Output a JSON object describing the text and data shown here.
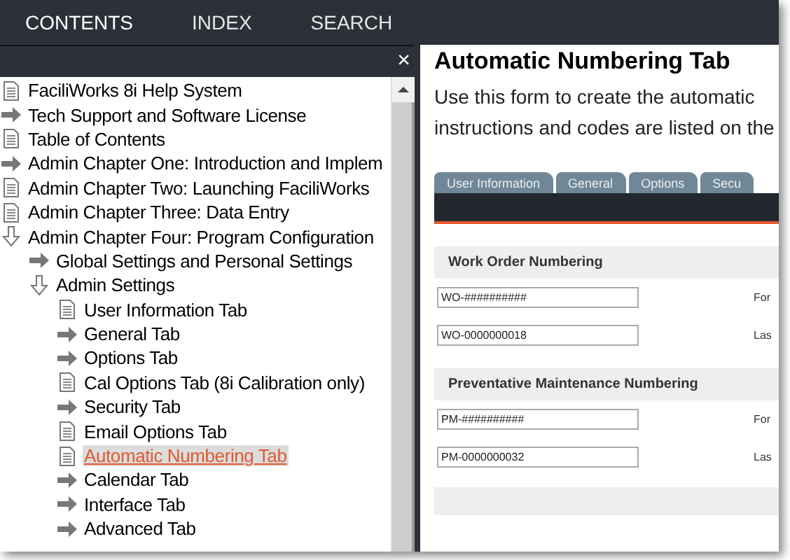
{
  "nav_tabs": [
    {
      "label": "CONTENTS",
      "selected": true
    },
    {
      "label": "INDEX",
      "selected": false
    },
    {
      "label": "SEARCH",
      "selected": false
    }
  ],
  "close_glyph": "×",
  "tree": [
    {
      "kind": "page",
      "label": "FaciliWorks 8i Help System",
      "selected": false
    },
    {
      "kind": "book",
      "label": "Tech Support and Software License",
      "selected": false
    },
    {
      "kind": "page",
      "label": "Table of Contents",
      "selected": false
    },
    {
      "kind": "book",
      "label": "Admin Chapter One: Introduction and Implem",
      "selected": false
    },
    {
      "kind": "page",
      "label": "Admin Chapter Two: Launching FaciliWorks",
      "selected": false
    },
    {
      "kind": "page",
      "label": "Admin Chapter Three: Data Entry",
      "selected": false
    },
    {
      "kind": "open",
      "label": "Admin Chapter Four: Program Configuration",
      "selected": false,
      "children": [
        {
          "kind": "book",
          "label": "Global Settings and Personal Settings",
          "selected": false
        },
        {
          "kind": "open",
          "label": "Admin Settings",
          "selected": false,
          "children": [
            {
              "kind": "page",
              "label": "User Information Tab",
              "selected": false
            },
            {
              "kind": "book",
              "label": "General Tab",
              "selected": false
            },
            {
              "kind": "book",
              "label": "Options Tab",
              "selected": false
            },
            {
              "kind": "page",
              "label": "Cal Options Tab (8i Calibration only)",
              "selected": false
            },
            {
              "kind": "book",
              "label": "Security Tab",
              "selected": false
            },
            {
              "kind": "page",
              "label": "Email Options Tab",
              "selected": false
            },
            {
              "kind": "page",
              "label": "Automatic Numbering Tab",
              "selected": true
            },
            {
              "kind": "book",
              "label": "Calendar Tab",
              "selected": false
            },
            {
              "kind": "book",
              "label": "Interface Tab",
              "selected": false
            },
            {
              "kind": "book",
              "label": "Advanced Tab",
              "selected": false
            }
          ]
        }
      ]
    }
  ],
  "page": {
    "title": "Automatic Numbering Tab",
    "intro_lines": [
      "Use this form to create the automatic",
      "instructions and codes are listed on the"
    ],
    "form_tabs": [
      "User Information",
      "General",
      "Options",
      "Secu"
    ],
    "sections": [
      {
        "heading": "Work Order Numbering",
        "fields": [
          {
            "value": "WO-##########",
            "side_label": "For"
          },
          {
            "value": "WO-0000000018",
            "side_label": "Las"
          }
        ]
      },
      {
        "heading": "Preventative Maintenance Numbering",
        "fields": [
          {
            "value": "PM-##########",
            "side_label": "For"
          },
          {
            "value": "PM-0000000032",
            "side_label": "Las"
          }
        ]
      }
    ]
  }
}
